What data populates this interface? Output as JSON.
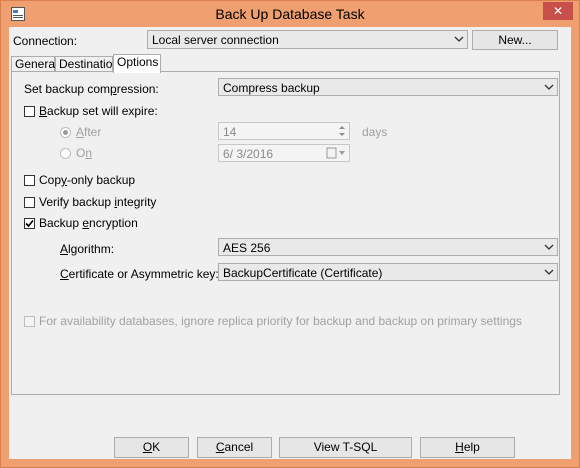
{
  "window": {
    "title": "Back Up Database Task",
    "close_glyph": "✕",
    "accent_color": "#f0a070"
  },
  "connection": {
    "label": "Connection:",
    "value": "Local server connection",
    "new_button": "New..."
  },
  "tabs": [
    {
      "label": "General",
      "active": false
    },
    {
      "label": "Destination",
      "active": false
    },
    {
      "label": "Options",
      "active": true
    }
  ],
  "options": {
    "compression_label_pre": "Set backup com",
    "compression_label_ul": "p",
    "compression_label_post": "ression:",
    "compression_value": "Compress backup",
    "expire_label_ul": "B",
    "expire_label_post": "ackup set will expire:",
    "expire_checked": false,
    "after_label_ul": "A",
    "after_label_post": "fter",
    "after_selected": true,
    "after_value": "14",
    "days_label": "days",
    "on_label_pre": "O",
    "on_label_ul": "n",
    "on_value": "6/  3/2016",
    "copy_only_pre": "Cop",
    "copy_only_ul": "y",
    "copy_only_post": "-only backup",
    "copy_only_checked": false,
    "verify_pre": "Verify backup ",
    "verify_ul": "i",
    "verify_post": "ntegrity",
    "verify_checked": false,
    "encryption_pre": "Backup ",
    "encryption_ul": "e",
    "encryption_post": "ncryption",
    "encryption_checked": true,
    "algorithm_ul": "A",
    "algorithm_post": "lgorithm:",
    "algorithm_value": "AES 256",
    "certificate_ul": "C",
    "certificate_post": "ertificate or Asymmetric key:",
    "certificate_value": "BackupCertificate (Certificate)",
    "availability_label": "For availability databases, ignore replica priority for backup and backup on primary settings",
    "availability_checked": false
  },
  "buttons": {
    "ok_ul": "O",
    "ok_post": "K",
    "cancel_ul": "C",
    "cancel_post": "ancel",
    "view_tsql": "View T-SQL",
    "help_ul": "H",
    "help_post": "elp"
  }
}
